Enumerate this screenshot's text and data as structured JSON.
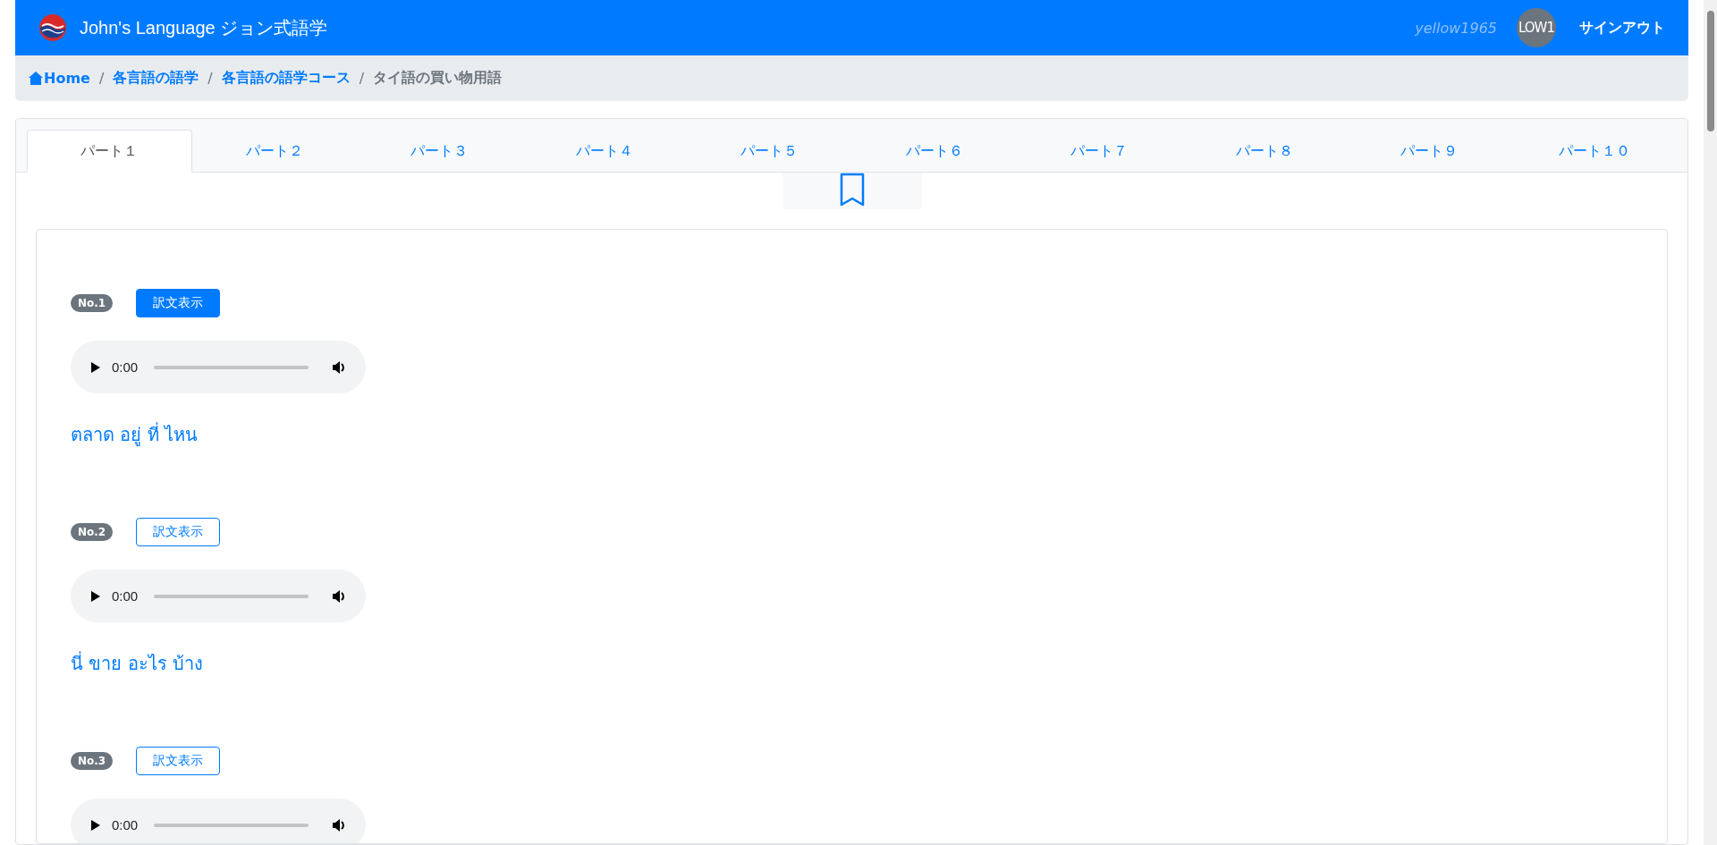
{
  "navbar": {
    "brand": "John's Language ジョン式語学",
    "username": "yellow1965",
    "avatar_text": "LOW1",
    "signout": "サインアウト"
  },
  "breadcrumb": [
    {
      "label": "Home",
      "kind": "home-link"
    },
    {
      "label": "各言語の語学",
      "kind": "link",
      "separator": "/"
    },
    {
      "label": "各言語の語学コース",
      "kind": "link",
      "separator": "/"
    },
    {
      "label": "タイ語の買い物用語",
      "kind": "current",
      "separator": "/"
    }
  ],
  "tabs": [
    {
      "label": "パート１",
      "selected": true
    },
    {
      "label": "パート２",
      "selected": false
    },
    {
      "label": "パート３",
      "selected": false
    },
    {
      "label": "パート４",
      "selected": false
    },
    {
      "label": "パート５",
      "selected": false
    },
    {
      "label": "パート６",
      "selected": false
    },
    {
      "label": "パート７",
      "selected": false
    },
    {
      "label": "パート８",
      "selected": false
    },
    {
      "label": "パート９",
      "selected": false
    },
    {
      "label": "パート１０",
      "selected": false
    }
  ],
  "items": [
    {
      "number": "No.1",
      "button": "訳文表示",
      "active": true,
      "time": "0:00",
      "level": 0,
      "phrase": "ตลาด อยู่ ที่ ไหน"
    },
    {
      "number": "No.2",
      "button": "訳文表示",
      "active": false,
      "time": "0:00",
      "level": 0,
      "phrase": "นี่ ขาย อะไร บ้าง"
    },
    {
      "number": "No.3",
      "button": "訳文表示",
      "active": false,
      "time": "0:00",
      "level": 0
    }
  ]
}
